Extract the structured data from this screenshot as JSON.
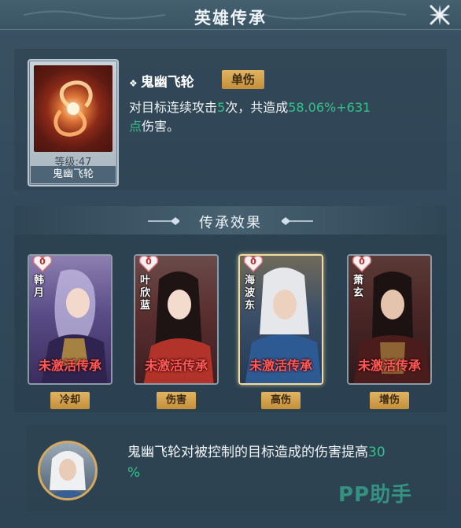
{
  "header": {
    "title": "英雄传承",
    "close_icon": "close-icon"
  },
  "skill": {
    "card_level": "等级:47",
    "card_name": "鬼幽飞轮",
    "name": "鬼幽飞轮",
    "type_badge": "单伤",
    "desc_prefix": "对目标连续攻击",
    "desc_hits": "5",
    "desc_mid": "次，共造成",
    "desc_value": "58.06%+631",
    "desc_value2": "点",
    "desc_suffix": "伤害。"
  },
  "inherit": {
    "title": "传承效果",
    "heroes": [
      {
        "name": "韩月",
        "hearts": "0",
        "status": "未激活传承",
        "tag": "冷却"
      },
      {
        "name": "叶欣蓝",
        "hearts": "0",
        "status": "未激活传承",
        "tag": "伤害"
      },
      {
        "name": "海波东",
        "hearts": "0",
        "status": "未激活传承",
        "tag": "高伤"
      },
      {
        "name": "萧玄",
        "hearts": "0",
        "status": "未激活传承",
        "tag": "增伤"
      }
    ]
  },
  "bonus": {
    "text": "鬼幽飞轮对被控制的目标造成的伤害提高",
    "value": "30",
    "unit": "%"
  },
  "watermark": "PP助手",
  "colors": {
    "highlight_green": "#33c28a",
    "inactive_red": "#ff5a5a",
    "badge_gold": "#d4a14e"
  }
}
